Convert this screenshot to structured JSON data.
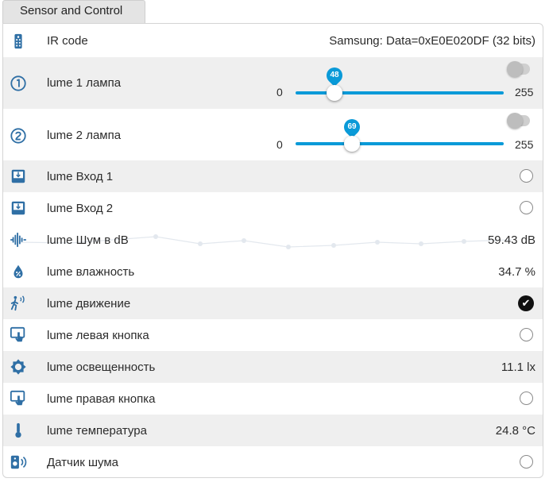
{
  "tab": {
    "label": "Sensor and Control"
  },
  "colors": {
    "accent": "#0a9ad8",
    "icon": "#2f6fa5",
    "alt_row": "#efefef"
  },
  "rows": [
    {
      "icon": "remote-icon",
      "label": "IR code",
      "value": "Samsung: Data=0xE0E020DF (32 bits)"
    },
    {
      "icon": "circle-1-icon",
      "label": "lume 1 лампа",
      "min": "0",
      "max": "255",
      "slider_value": 48,
      "pin": "48",
      "toggle_on": false
    },
    {
      "icon": "circle-2-icon",
      "label": "lume 2 лампа",
      "min": "0",
      "max": "255",
      "slider_value": 69,
      "pin": "69",
      "toggle_on": false
    },
    {
      "icon": "inbox-icon",
      "label": "lume Вход 1",
      "state": "off"
    },
    {
      "icon": "inbox-icon",
      "label": "lume Вход 2",
      "state": "off"
    },
    {
      "icon": "waveform-icon",
      "label": "lume Шум в dB",
      "value": "59.43 dB"
    },
    {
      "icon": "water-percent-icon",
      "label": "lume влажность",
      "value": "34.7 %"
    },
    {
      "icon": "motion-sensor-icon",
      "label": "lume движение",
      "state": "on"
    },
    {
      "icon": "gesture-tap-icon",
      "label": "lume левая кнопка",
      "state": "off"
    },
    {
      "icon": "brightness-icon",
      "label": "lume освещенность",
      "value": "11.1 lx"
    },
    {
      "icon": "gesture-tap-icon",
      "label": "lume правая кнопка",
      "state": "off"
    },
    {
      "icon": "thermometer-icon",
      "label": "lume температура",
      "value": "24.8 °C"
    },
    {
      "icon": "speaker-icon",
      "label": "Датчик шума",
      "state": "off"
    }
  ]
}
